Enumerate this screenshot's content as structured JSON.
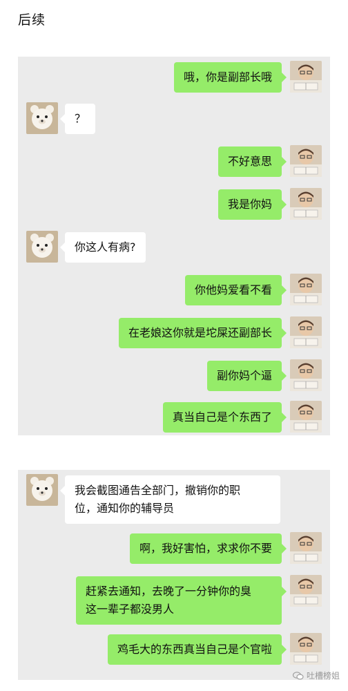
{
  "title": "后续",
  "panel1": [
    {
      "side": "me",
      "text": "哦，你是副部长哦"
    },
    {
      "side": "other",
      "text": "？"
    },
    {
      "side": "me",
      "text": "不好意思"
    },
    {
      "side": "me",
      "text": "我是你妈"
    },
    {
      "side": "other",
      "text": "你这人有病?"
    },
    {
      "side": "me",
      "text": "你他妈爱看不看"
    },
    {
      "side": "me",
      "text": "在老娘这你就是坨屎还副部长"
    },
    {
      "side": "me",
      "text": "副你妈个逼"
    },
    {
      "side": "me",
      "text": "真当自己是个东西了"
    }
  ],
  "panel2": [
    {
      "side": "other",
      "text": "我会截图通告全部门，撤销你的职\n位，通知你的辅导员"
    },
    {
      "side": "me",
      "text": "啊，我好害怕，求求你不要"
    },
    {
      "side": "me",
      "text": "赶紧去通知，去晚了一分钟你的臭\n这一辈子都没男人"
    },
    {
      "side": "me",
      "text": "鸡毛大的东西真当自己是个官啦"
    }
  ],
  "watermark": "吐槽榜姐",
  "colors": {
    "me_bubble": "#95ec69",
    "other_bubble": "#ffffff",
    "panel": "#ebebeb"
  }
}
